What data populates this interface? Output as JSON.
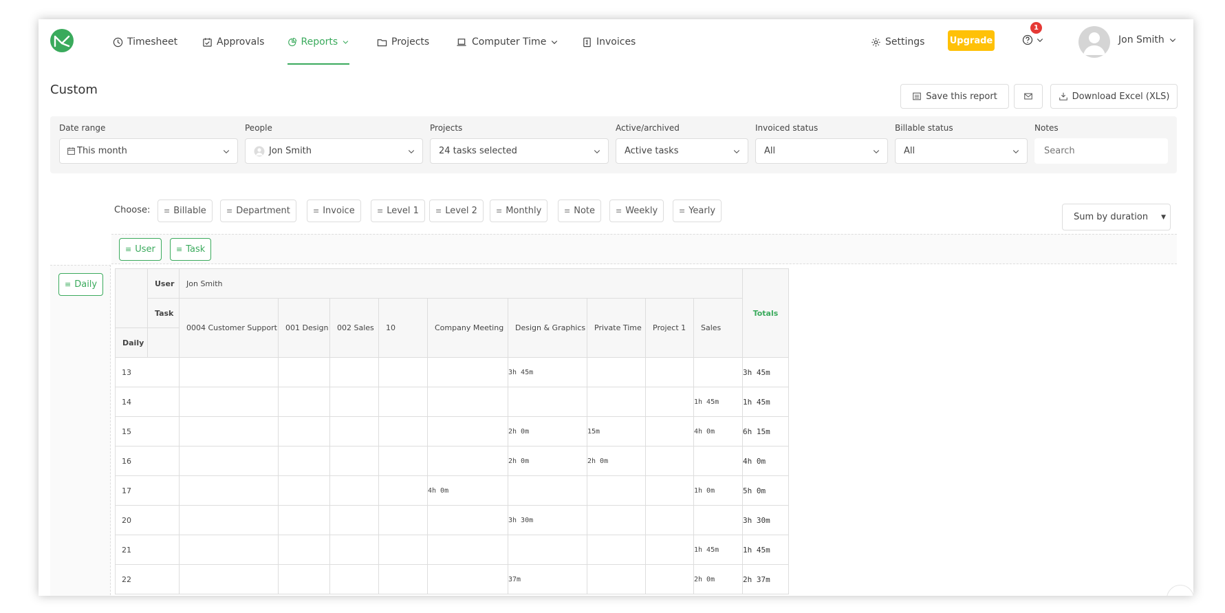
{
  "nav": {
    "items": [
      {
        "label": "Timesheet",
        "icon": "clock-icon"
      },
      {
        "label": "Approvals",
        "icon": "calendar-check-icon"
      },
      {
        "label": "Reports",
        "icon": "pie-chart-icon",
        "active": true
      },
      {
        "label": "Projects",
        "icon": "folder-icon"
      },
      {
        "label": "Computer Time",
        "icon": "laptop-icon"
      },
      {
        "label": "Invoices",
        "icon": "invoice-icon"
      }
    ],
    "settings": "Settings",
    "upgrade": "Upgrade",
    "notifications": "1",
    "user": "Jon Smith"
  },
  "page": {
    "title": "Custom",
    "save_report": "Save this report",
    "download": "Download Excel (XLS)"
  },
  "filters": {
    "date_range": {
      "label": "Date range",
      "value": "This month"
    },
    "people": {
      "label": "People",
      "value": "Jon Smith"
    },
    "projects": {
      "label": "Projects",
      "value": "24 tasks selected"
    },
    "active": {
      "label": "Active/archived",
      "value": "Active tasks"
    },
    "invoiced": {
      "label": "Invoiced status",
      "value": "All"
    },
    "billable": {
      "label": "Billable status",
      "value": "All"
    },
    "notes": {
      "label": "Notes",
      "placeholder": "Search"
    }
  },
  "choose": {
    "label": "Choose:",
    "chips": [
      "Billable",
      "Department",
      "Invoice",
      "Level 1",
      "Level 2",
      "Monthly",
      "Note",
      "Weekly",
      "Yearly"
    ]
  },
  "sum_by": "Sum by duration",
  "groupings": {
    "columns": [
      "User",
      "Task"
    ],
    "rows": [
      "Daily"
    ]
  },
  "table": {
    "user_label": "User",
    "task_label": "Task",
    "daily_label": "Daily",
    "user_value": "Jon Smith",
    "totals_label": "Totals",
    "tasks": [
      "0004 Customer Support",
      "001 Design",
      "002 Sales",
      "10",
      "Company Meeting",
      "Design & Graphics",
      "Private Time",
      "Project 1",
      "Sales"
    ],
    "rows": [
      {
        "day": "13",
        "cells": [
          "",
          "",
          "",
          "",
          "",
          "3h 45m",
          "",
          "",
          ""
        ],
        "total": "3h 45m"
      },
      {
        "day": "14",
        "cells": [
          "",
          "",
          "",
          "",
          "",
          "",
          "",
          "",
          "1h 45m"
        ],
        "total": "1h 45m"
      },
      {
        "day": "15",
        "cells": [
          "",
          "",
          "",
          "",
          "",
          "2h 0m",
          "15m",
          "",
          "4h 0m"
        ],
        "total": "6h 15m"
      },
      {
        "day": "16",
        "cells": [
          "",
          "",
          "",
          "",
          "",
          "2h 0m",
          "2h 0m",
          "",
          ""
        ],
        "total": "4h 0m"
      },
      {
        "day": "17",
        "cells": [
          "",
          "",
          "",
          "",
          "4h 0m",
          "",
          "",
          "",
          "1h 0m"
        ],
        "total": "5h 0m"
      },
      {
        "day": "20",
        "cells": [
          "",
          "",
          "",
          "",
          "",
          "3h 30m",
          "",
          "",
          ""
        ],
        "total": "3h 30m"
      },
      {
        "day": "21",
        "cells": [
          "",
          "",
          "",
          "",
          "",
          "",
          "",
          "",
          "1h 45m"
        ],
        "total": "1h 45m"
      },
      {
        "day": "22",
        "cells": [
          "",
          "",
          "",
          "",
          "",
          "37m",
          "",
          "",
          "2h 0m"
        ],
        "total": "2h 37m"
      }
    ]
  },
  "colors": {
    "accent": "#3aaa5c",
    "upgrade": "#ffc107",
    "badge": "#e53935"
  }
}
